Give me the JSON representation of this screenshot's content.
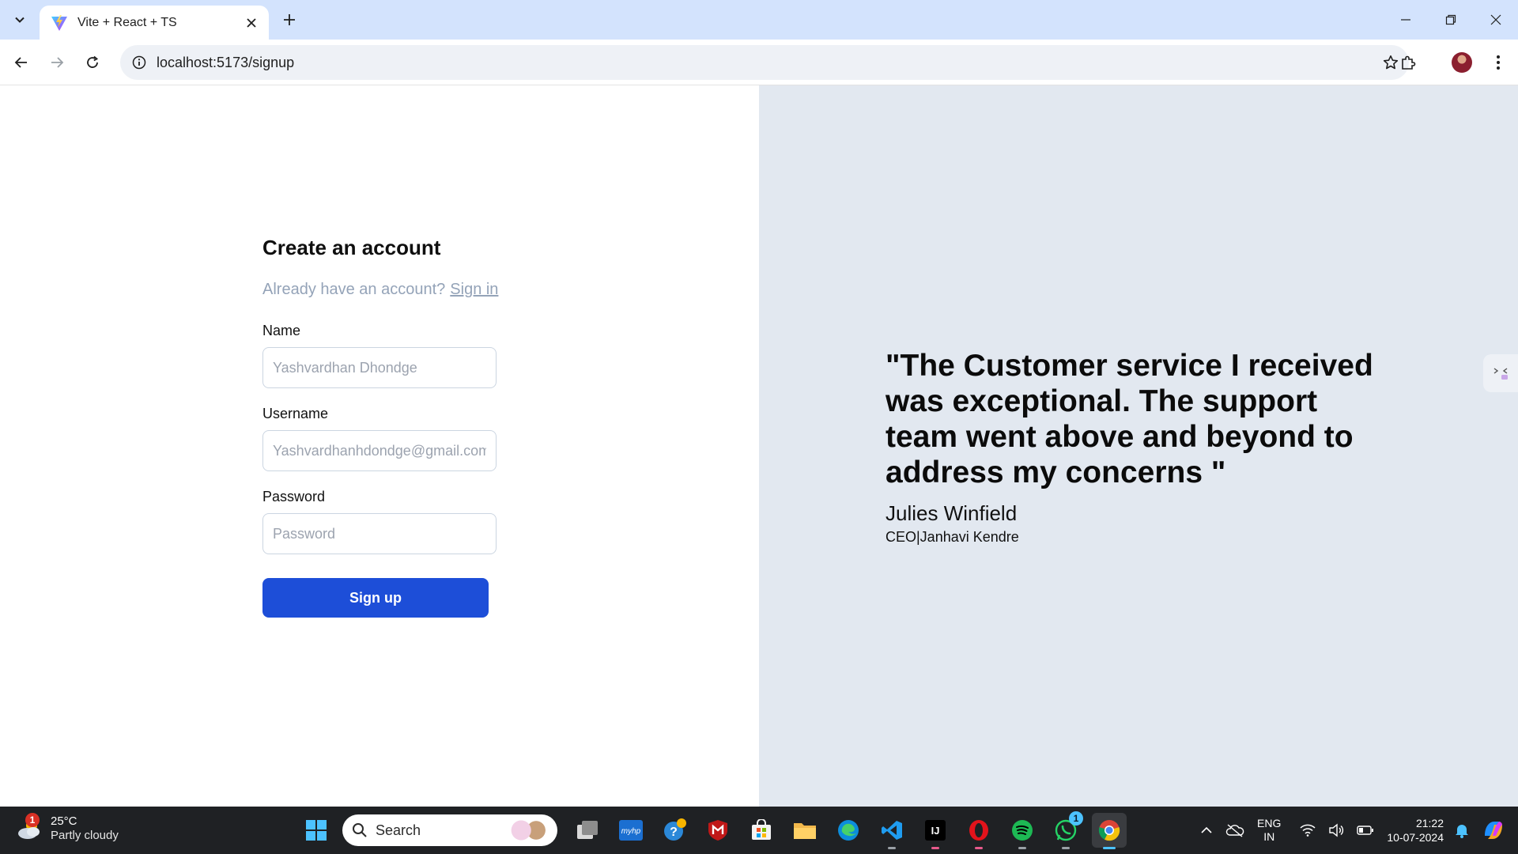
{
  "browser": {
    "tab_title": "Vite + React + TS",
    "url": "localhost:5173/signup"
  },
  "signup": {
    "title": "Create an account",
    "already_text": "Already have an account?",
    "signin_label": "Sign in",
    "fields": {
      "name_label": "Name",
      "name_placeholder": "Yashvardhan Dhondge",
      "username_label": "Username",
      "username_placeholder": "Yashvardhanhdondge@gmail.com",
      "password_label": "Password",
      "password_placeholder": "Password"
    },
    "submit_label": "Sign up"
  },
  "testimonial": {
    "quote": "\"The Customer service I received was exceptional. The support team went above and beyond to address my concerns \"",
    "author": "Julies Winfield",
    "role": "CEO|Janhavi Kendre"
  },
  "taskbar": {
    "weather_temp": "25°C",
    "weather_desc": "Partly cloudy",
    "weather_badge": "1",
    "search_label": "Search",
    "whatsapp_badge": "1",
    "lang_line1": "ENG",
    "lang_line2": "IN",
    "time": "21:22",
    "date": "10-07-2024"
  },
  "colors": {
    "accent_button": "#1d4ed8",
    "right_pane": "#e2e8f0",
    "tabbar": "#d3e3fd"
  }
}
